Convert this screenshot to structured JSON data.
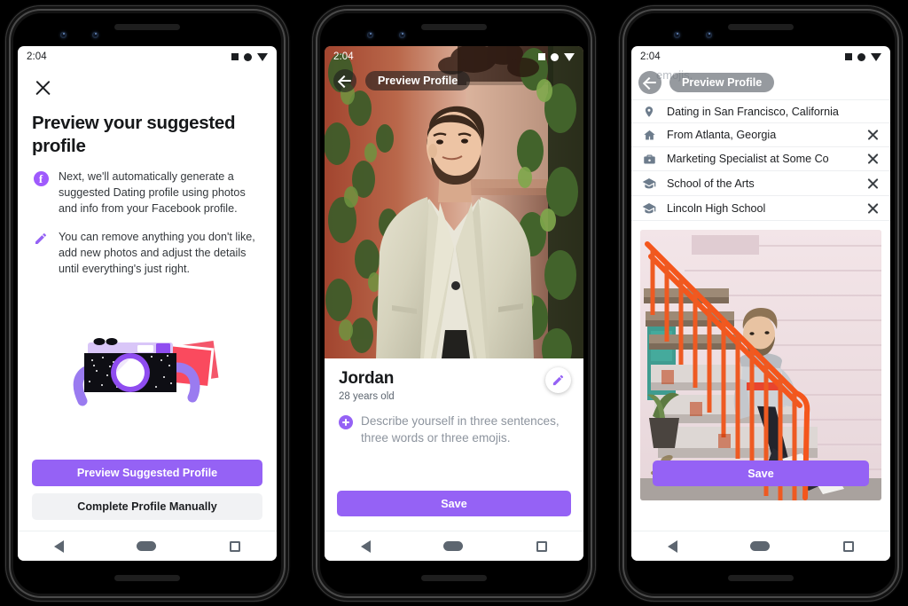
{
  "background_color": "#000000",
  "accent_purple": "#9562f5",
  "phones": [
    {
      "id": "phone-1",
      "status_bar": {
        "time": "2:04",
        "icons": [
          "square-icon",
          "circle-icon",
          "triangle-down-icon"
        ]
      },
      "close_icon": "close-icon",
      "title": "Preview your suggested profile",
      "bullets": [
        {
          "icon": "facebook-icon",
          "glyph": "f",
          "text": "Next, we'll automatically generate a suggested Dating profile using photos and info from your Facebook profile."
        },
        {
          "icon": "pencil-icon",
          "text": "You can remove anything you don't like, add new photos and adjust the details until everything's just right."
        }
      ],
      "illustration": "camera-with-photos-illustration",
      "buttons": {
        "primary_label": "Preview Suggested Profile",
        "secondary_label": "Complete Profile Manually"
      },
      "nav_bar": [
        "back-icon",
        "home-icon",
        "recents-icon"
      ]
    },
    {
      "id": "phone-2",
      "status_bar": {
        "time": "2:04",
        "icons": [
          "square-icon",
          "circle-icon",
          "triangle-down-icon"
        ]
      },
      "header": {
        "back_icon": "arrow-left-icon",
        "title": "Preview Profile"
      },
      "photo": "man-in-cream-suit-against-ivy-wall",
      "name": "Jordan",
      "age": "28 years old",
      "edit_icon": "pencil-icon",
      "prompt": "Describe yourself in three sentences, three words or three emojis.",
      "save_label": "Save",
      "nav_bar": [
        "back-icon",
        "home-icon",
        "recents-icon"
      ]
    },
    {
      "id": "phone-3",
      "status_bar": {
        "time": "2:04",
        "icons": [
          "square-icon",
          "circle-icon",
          "triangle-down-icon"
        ]
      },
      "ghost_text": "emojis.",
      "header": {
        "back_icon": "arrow-left-icon",
        "title": "Preview Profile"
      },
      "list": [
        {
          "icon": "location-pin-icon",
          "label": "Dating in San Francisco, California",
          "removable": false
        },
        {
          "icon": "home-icon",
          "label": "From Atlanta, Georgia",
          "removable": true
        },
        {
          "icon": "briefcase-icon",
          "label": "Marketing Specialist at Some Co",
          "removable": true
        },
        {
          "icon": "graduation-cap-icon",
          "label": "School of the Arts",
          "removable": true
        },
        {
          "icon": "graduation-cap-icon",
          "label": "Lincoln High School",
          "removable": true
        }
      ],
      "remove_icon": "close-icon",
      "photo": "man-on-steps-with-orange-railing",
      "save_label": "Save",
      "nav_bar": [
        "back-icon",
        "home-icon",
        "recents-icon"
      ]
    }
  ]
}
